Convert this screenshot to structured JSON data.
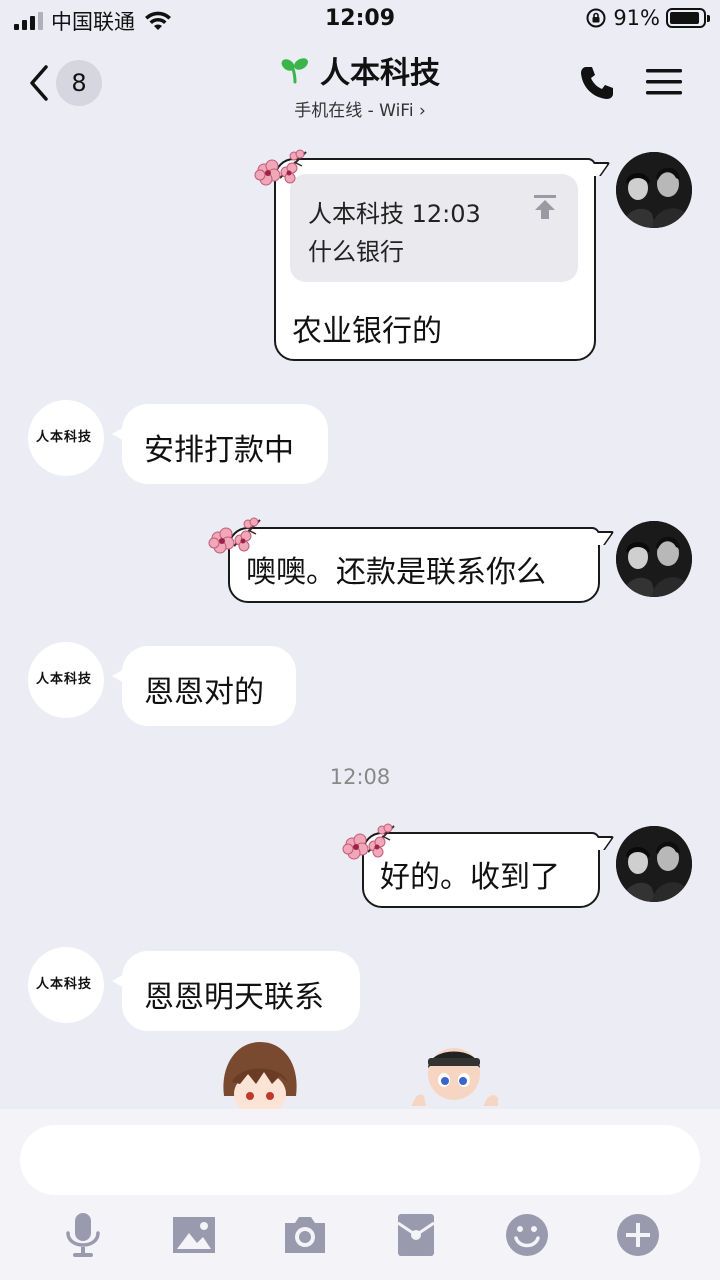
{
  "status_bar": {
    "carrier": "中国联通",
    "time": "12:09",
    "battery": "91%",
    "battery_level": 0.91
  },
  "nav": {
    "unread_count": "8",
    "title": "人本科技",
    "subtitle": "手机在线 - WiFi ›"
  },
  "messages": {
    "m1": {
      "quote_header": "人本科技 12:03",
      "quote_text": "什么银行",
      "text": "农业银行的"
    },
    "m2": {
      "text": "安排打款中"
    },
    "m3": {
      "text": "噢噢。还款是联系你么"
    },
    "m4": {
      "text": "恩恩对的"
    },
    "timestamp": "12:08",
    "m5": {
      "text": "好的。收到了"
    },
    "m6": {
      "text": "恩恩明天联系"
    }
  },
  "contact_logo_text": "人本科技",
  "input": {
    "placeholder": ""
  },
  "toolbar_icons": [
    "microphone-icon",
    "image-icon",
    "camera-icon",
    "red-packet-icon",
    "emoji-icon",
    "plus-icon"
  ],
  "colors": {
    "background": "#ececf5",
    "bubble": "#ffffff",
    "icon_gray": "#9a9aae",
    "accent_green": "#3bb54a"
  }
}
